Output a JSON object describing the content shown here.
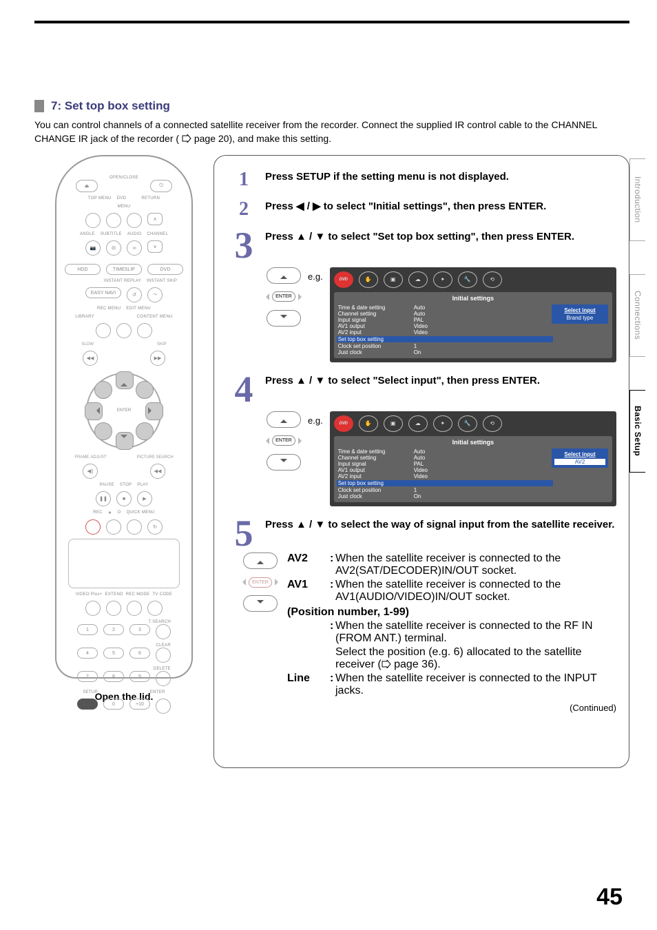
{
  "page_number": "45",
  "section": {
    "number": "7:",
    "title": "Set top box setting",
    "intro_a": "You can control channels of a connected satellite receiver from the recorder. Connect the supplied IR control cable to the CHANNEL CHANGE IR jack of the recorder (",
    "intro_page_ref": " page 20",
    "intro_b": "), and make this setting."
  },
  "tabs": {
    "intro": "Introduction",
    "conn": "Connections",
    "basic": "Basic Setup"
  },
  "remote": {
    "open_close": "OPEN/CLOSE",
    "dvd": "DVD",
    "top_menu": "TOP MENU",
    "menu": "MENU",
    "return": "RETURN",
    "angle": "ANGLE",
    "subtitle": "SUBTITLE",
    "audio": "AUDIO",
    "channel": "CHANNEL",
    "hdd": "HDD",
    "timeslip": "TIMESLIP",
    "dvd2": "DVD",
    "instant_replay": "INSTANT REPLAY",
    "instant_skip": "INSTANT SKIP",
    "easy_navi": "EASY NAVI",
    "rec_menu": "REC MENU",
    "edit_menu": "EDIT MENU",
    "library": "LIBRARY",
    "content_menu": "CONTENT MENU",
    "slow": "SLOW",
    "skip": "SKIP",
    "enter": "ENTER",
    "frame_adjust": "FRAME",
    "adjust": "ADJUST",
    "picture_search": "PICTURE SEARCH",
    "pause": "PAUSE",
    "stop": "STOP",
    "play": "PLAY",
    "rec": "REC",
    "star": "★",
    "circle_o": "O",
    "quick_menu": "QUICK MENU",
    "videoplus": "VIDEO Plus+",
    "extend": "EXTEND",
    "rec_mode": "REC MODE",
    "tv_code": "TV CODE",
    "tsearch": "T.SEARCH",
    "clear": "CLEAR",
    "delete": "DELETE",
    "num1": "1",
    "num2": "2",
    "num3": "3",
    "num4": "4",
    "num5": "5",
    "num6": "6",
    "num7": "7",
    "num8": "8",
    "num9": "9",
    "num0": "0",
    "num10": "+10",
    "setup": "SETUP",
    "enter2": "ENTER",
    "open_lid": "Open the lid."
  },
  "steps": {
    "s1": {
      "n": "1",
      "text": "Press SETUP if the setting menu is not displayed."
    },
    "s2": {
      "n": "2",
      "text_a": "Press ",
      "text_b": " to select \"Initial settings\", then press ENTER.",
      "glyph": "◀ / ▶"
    },
    "s3": {
      "n": "3",
      "text_a": "Press ",
      "glyph": "▲ / ▼",
      "text_b": " to select \"Set top box setting\", then press ENTER."
    },
    "s4": {
      "n": "4",
      "text_a": "Press ",
      "glyph": "▲ / ▼",
      "text_b": " to select \"Select input\", then press ENTER."
    },
    "s5": {
      "n": "5",
      "text_a": "Press ",
      "glyph": "▲ / ▼",
      "text_b": " to select the way of signal input from the satellite receiver."
    }
  },
  "eg_label": "e.g.",
  "menu": {
    "title": "Initial settings",
    "items": [
      {
        "k": "Time & date setting",
        "v": "Auto"
      },
      {
        "k": "Channel setting",
        "v": "Auto"
      },
      {
        "k": "Input signal",
        "v": "PAL"
      },
      {
        "k": "AV1 output",
        "v": "Video"
      },
      {
        "k": "AV2 input",
        "v": "Video"
      },
      {
        "k": "Set top box setting",
        "v": ""
      },
      {
        "k": "Clock set position",
        "v": "1"
      },
      {
        "k": "Just clock",
        "v": "On"
      }
    ],
    "side_a": {
      "head": "Select input",
      "val": "Brand type"
    },
    "side_b": {
      "head": "Select input",
      "val": "AV2"
    }
  },
  "dpad_enter": "ENTER",
  "options": {
    "av2": {
      "label": "AV2",
      "desc": "When the satellite receiver is connected to the AV2(SAT/DECODER)IN/OUT socket."
    },
    "av1": {
      "label": "AV1",
      "desc": "When the satellite receiver is connected to the AV1(AUDIO/VIDEO)IN/OUT socket."
    },
    "pos_head": "(Position number, 1-99)",
    "pos_a": "When the satellite receiver is connected to the RF IN (FROM ANT.) terminal.",
    "pos_b_a": "Select the position (e.g. 6) allocated to the satellite receiver (",
    "pos_b_ref": " page 36",
    "pos_b_b": ").",
    "line": {
      "label": "Line",
      "desc": "When the satellite receiver is connected to the INPUT jacks."
    }
  },
  "continued": "(Continued)"
}
